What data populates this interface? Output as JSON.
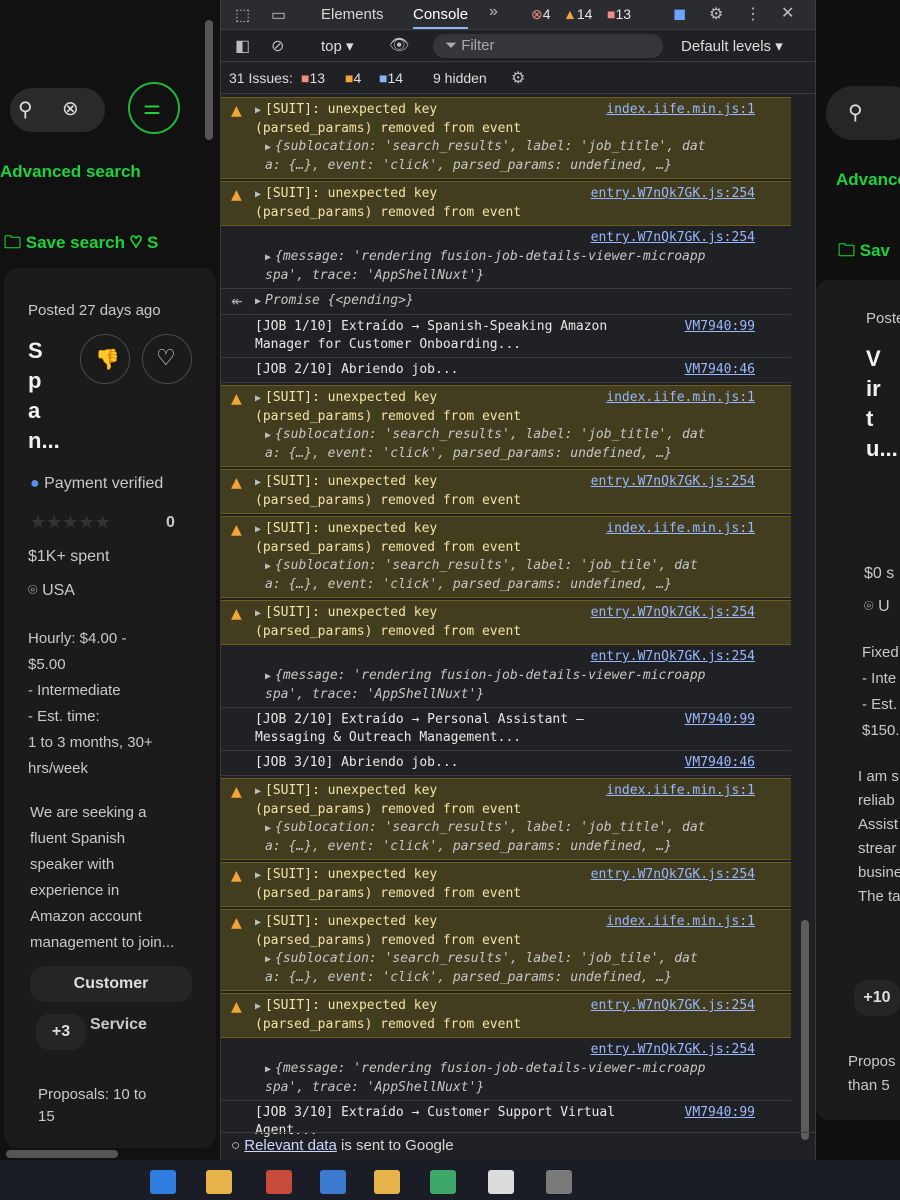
{
  "left": {
    "advanced_search": "Advanced search",
    "save_search": "Save search",
    "posted": "Posted 27 days ago",
    "title_letters": [
      "S",
      "p",
      "a",
      "n..."
    ],
    "payment": "Payment verified",
    "rating_count": "0",
    "spent": "$1K+ spent",
    "location": "USA",
    "details": [
      "Hourly: $4.00 -",
      "$5.00",
      "- Intermediate",
      "- Est. time:",
      "1 to 3 months, 30+",
      "hrs/week"
    ],
    "description": [
      "We are seeking a",
      "fluent Spanish",
      "speaker with",
      "experience in",
      "Amazon account",
      "management to join..."
    ],
    "skill_chip": "Customer",
    "skill_chip2": "Service",
    "more_chip": "+3",
    "proposals": [
      "Proposals: 10 to",
      "15"
    ]
  },
  "right": {
    "advanced_search": "Advance",
    "save_search": "Sav",
    "posted": "Poste",
    "title_letters": [
      "V",
      "ir",
      "t",
      "u..."
    ],
    "spent": "$0 s",
    "location": "U",
    "details": [
      "Fixed",
      "- Inte",
      "- Est.",
      "$150."
    ],
    "description": [
      "I am s",
      "reliab",
      "Assist",
      "strear",
      "busine",
      "The ta"
    ],
    "more_chip": "+10",
    "proposals": [
      "Propos",
      "than 5"
    ]
  },
  "devtools": {
    "tabs": [
      "Elements",
      "Console"
    ],
    "active_tab": "Console",
    "errors": "4",
    "warnings": "14",
    "infos": "13",
    "context": "top",
    "filter_placeholder": "Filter",
    "levels": "Default levels",
    "issues_label": "31 Issues:",
    "issues_errors": "13",
    "issues_warnings": "4",
    "issues_infos": "14",
    "hidden": "9 hidden",
    "footer_link": "Relevant data",
    "footer_text": "is sent to Google"
  },
  "console": {
    "suit_line1": "[SUIT]: unexpected key",
    "suit_line2": "(parsed_params) removed from event",
    "src_iife": "index.iife.min.js:1",
    "src_entry": "entry.W7nQk7GK.js:254",
    "obj_line1a": "{sublocation: 'search_results', label: 'job_title', dat",
    "obj_line2a": "a: {…}, event: 'click', parsed_params: undefined, …}",
    "obj_line1b": "{sublocation: 'search_results', label: 'job_tile', dat",
    "msg_line1": "{message: 'rendering fusion-job-details-viewer-microapp",
    "msg_line2": "spa', trace: 'AppShellNuxt'}",
    "promise": "Promise {<pending>}",
    "job1_extract_1": "[JOB 1/10] Extraído → Spanish-Speaking Amazon",
    "job1_extract_2": "Manager for Customer Onboarding...",
    "job2_open": "[JOB 2/10] Abriendo job...",
    "job2_extract_1": "[JOB 2/10] Extraído → Personal Assistant –",
    "job2_extract_2": "Messaging & Outreach Management...",
    "job3_open": "[JOB 3/10] Abriendo job...",
    "job3_extract_1": "[JOB 3/10] Extraído → Customer Support Virtual",
    "job3_extract_2": "Agent...",
    "src_vm99": "VM7940:99",
    "src_vm46": "VM7940:46",
    "prompt": ">"
  },
  "colors": {
    "green": "#1fd13b",
    "warn_bg": "#413d1e",
    "link": "#9ab7ff",
    "string": "#f28b54"
  }
}
